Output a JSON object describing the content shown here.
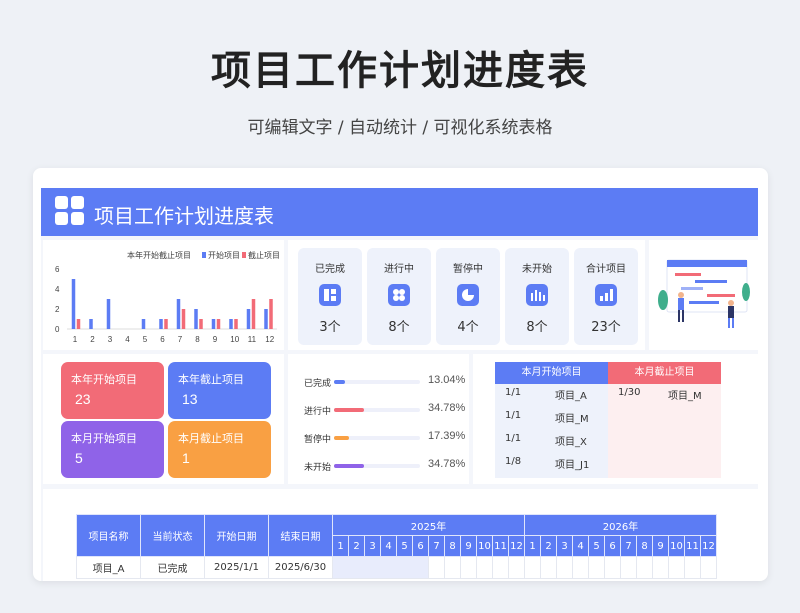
{
  "title": "项目工作计划进度表",
  "subtitle": "可编辑文字  /  自动统计  /  可视化系统表格",
  "header": {
    "title": "项目工作计划进度表",
    "icon": "grid-icon"
  },
  "colors": {
    "accent": "#5c7cf4",
    "red": "#f26b77",
    "purple": "#8f63e8",
    "orange": "#f9a043"
  },
  "chart_data": {
    "type": "bar",
    "title": "本年开始截止项目",
    "categories": [
      "1",
      "2",
      "3",
      "4",
      "5",
      "6",
      "7",
      "8",
      "9",
      "10",
      "11",
      "12"
    ],
    "series": [
      {
        "name": "开始项目",
        "color": "#5c7cf4",
        "values": [
          5,
          1,
          3,
          0,
          1,
          1,
          3,
          2,
          1,
          1,
          2,
          2
        ]
      },
      {
        "name": "截止项目",
        "color": "#f26b77",
        "values": [
          1,
          0,
          0,
          0,
          0,
          1,
          2,
          1,
          1,
          1,
          3,
          3
        ]
      }
    ],
    "yticks": [
      "0",
      "2",
      "4",
      "6"
    ],
    "ylim": [
      0,
      6
    ]
  },
  "stats": [
    {
      "label": "已完成",
      "value": "3个",
      "icon": "layout-icon"
    },
    {
      "label": "进行中",
      "value": "8个",
      "icon": "clover-icon"
    },
    {
      "label": "暂停中",
      "value": "4个",
      "icon": "pie-icon"
    },
    {
      "label": "未开始",
      "value": "8个",
      "icon": "bars-icon"
    },
    {
      "label": "合计项目",
      "value": "23个",
      "icon": "growth-icon"
    }
  ],
  "tiles": [
    {
      "label": "本年开始项目",
      "value": "23"
    },
    {
      "label": "本年截止项目",
      "value": "13"
    },
    {
      "label": "本月开始项目",
      "value": "5"
    },
    {
      "label": "本月截止项目",
      "value": "1"
    }
  ],
  "progress": [
    {
      "label": "已完成",
      "value": "13.04%",
      "pct": 13.04,
      "color": "#5c7cf4"
    },
    {
      "label": "进行中",
      "value": "34.78%",
      "pct": 34.78,
      "color": "#f26b77"
    },
    {
      "label": "暂停中",
      "value": "17.39%",
      "pct": 17.39,
      "color": "#f9a043"
    },
    {
      "label": "未开始",
      "value": "34.78%",
      "pct": 34.78,
      "color": "#8f63e8"
    }
  ],
  "month_start": {
    "header": "本月开始项目",
    "rows": [
      [
        "1/1",
        "项目_A"
      ],
      [
        "1/1",
        "项目_M"
      ],
      [
        "1/1",
        "项目_X"
      ],
      [
        "1/8",
        "项目_J1"
      ]
    ]
  },
  "month_end": {
    "header": "本月截止项目",
    "rows": [
      [
        "1/30",
        "项目_M"
      ]
    ]
  },
  "gantt": {
    "columns": [
      "项目名称",
      "当前状态",
      "开始日期",
      "结束日期"
    ],
    "years": [
      "2025年",
      "2026年"
    ],
    "months": [
      "1",
      "2",
      "3",
      "4",
      "5",
      "6",
      "7",
      "8",
      "9",
      "10",
      "11",
      "12"
    ],
    "rows": [
      {
        "name": "项目_A",
        "status": "已完成",
        "start": "2025/1/1",
        "end": "2025/6/30",
        "bar_months": 6
      }
    ]
  }
}
